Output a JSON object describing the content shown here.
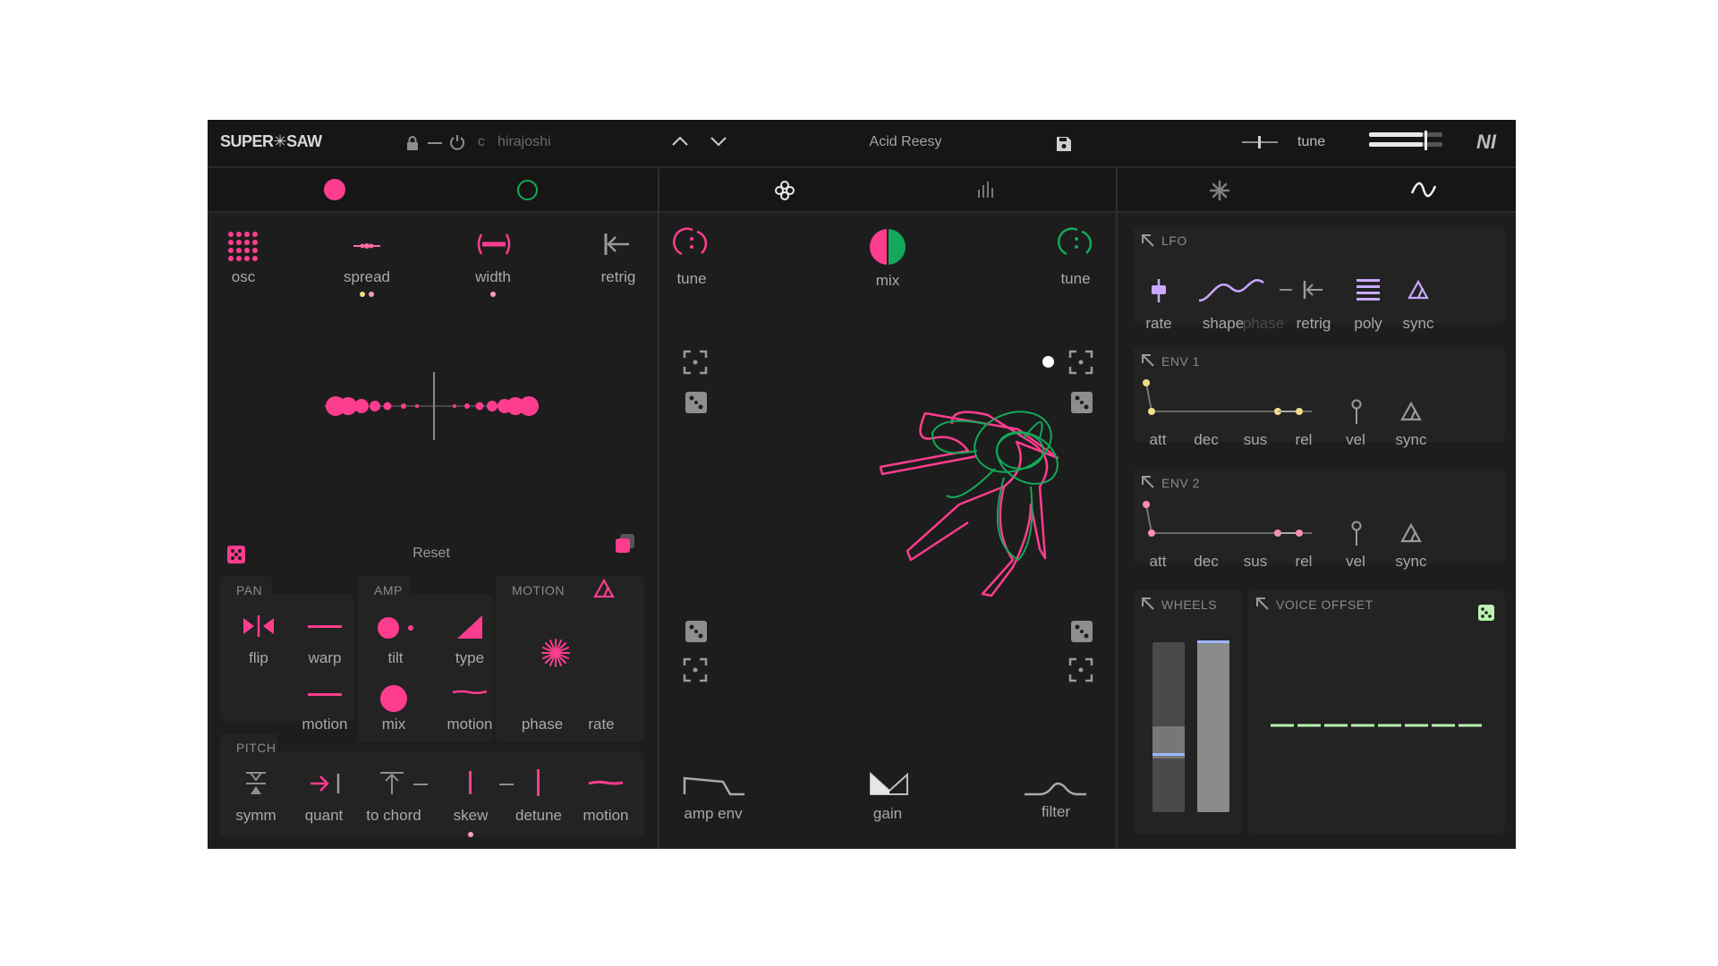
{
  "header": {
    "logo": "SUPER✳SAW",
    "key": "c",
    "scale": "hirajoshi",
    "preset_name": "Acid Reesy",
    "tune_label": "tune",
    "brand": "NI"
  },
  "tabs": {
    "left": [
      "osc-a",
      "osc-b"
    ],
    "center": [
      "motion-view",
      "spectrum-view"
    ],
    "right": [
      "effects",
      "modulation"
    ]
  },
  "osc": {
    "controls": [
      {
        "label": "osc",
        "icon": "grid-icon"
      },
      {
        "label": "spread",
        "icon": "spread-icon"
      },
      {
        "label": "width",
        "icon": "width-icon"
      },
      {
        "label": "retrig",
        "icon": "retrig-icon"
      }
    ],
    "reset_label": "Reset"
  },
  "pan": {
    "title": "PAN",
    "controls": [
      {
        "label": "flip"
      },
      {
        "label": "warp"
      },
      {
        "label": "motion"
      }
    ]
  },
  "amp": {
    "title": "AMP",
    "controls": [
      {
        "label": "tilt"
      },
      {
        "label": "type"
      },
      {
        "label": "mix"
      },
      {
        "label": "motion"
      }
    ]
  },
  "motion": {
    "title": "MOTION",
    "controls": [
      {
        "label": "phase"
      },
      {
        "label": "rate"
      }
    ]
  },
  "pitch": {
    "title": "PITCH",
    "controls": [
      {
        "label": "symm"
      },
      {
        "label": "quant"
      },
      {
        "label": "to chord"
      },
      {
        "label": "skew"
      },
      {
        "label": "detune"
      },
      {
        "label": "motion"
      }
    ]
  },
  "center": {
    "tune_left": "tune",
    "mix": "mix",
    "tune_right": "tune",
    "bottom": [
      {
        "label": "amp env"
      },
      {
        "label": "gain"
      },
      {
        "label": "filter"
      }
    ]
  },
  "lfo": {
    "title": "LFO",
    "controls": [
      {
        "label": "rate"
      },
      {
        "label": "shape"
      },
      {
        "label": "phase"
      },
      {
        "label": "retrig"
      },
      {
        "label": "poly"
      },
      {
        "label": "sync"
      }
    ]
  },
  "env1": {
    "title": "ENV 1",
    "controls": [
      {
        "label": "att"
      },
      {
        "label": "dec"
      },
      {
        "label": "sus"
      },
      {
        "label": "rel"
      },
      {
        "label": "vel"
      },
      {
        "label": "sync"
      }
    ]
  },
  "env2": {
    "title": "ENV 2",
    "controls": [
      {
        "label": "att"
      },
      {
        "label": "dec"
      },
      {
        "label": "sus"
      },
      {
        "label": "rel"
      },
      {
        "label": "vel"
      },
      {
        "label": "sync"
      }
    ]
  },
  "wheels": {
    "title": "WHEELS"
  },
  "voice_offset": {
    "title": "VOICE OFFSET"
  },
  "colors": {
    "background": "#1d1d1d",
    "accent_pink": "#ff3d8e",
    "accent_green": "#14a85a",
    "lfo_purple": "#c9a8ff",
    "env_yellow": "#f3dc8a",
    "wheel_blue": "#9bb7ff",
    "voice_green": "#b9f3b0"
  }
}
